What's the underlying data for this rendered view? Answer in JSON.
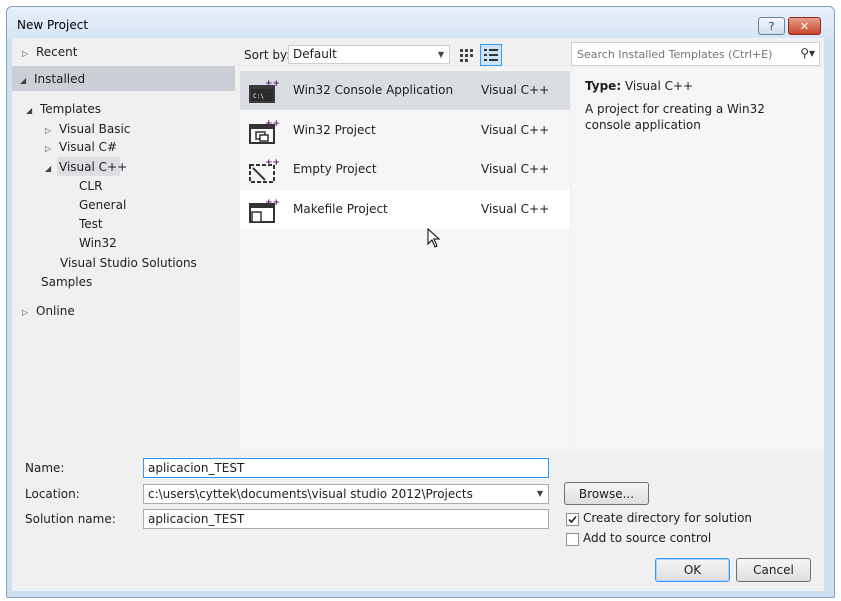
{
  "window": {
    "title": "New Project",
    "help_glyph": "?",
    "close_glyph": "✕"
  },
  "nav": {
    "recent": "Recent",
    "installed": "Installed",
    "templates": "Templates",
    "visual_basic": "Visual Basic",
    "visual_csharp": "Visual C#",
    "visual_cpp": "Visual C++",
    "clr": "CLR",
    "general": "General",
    "test": "Test",
    "win32": "Win32",
    "vs_solutions": "Visual Studio Solutions",
    "samples": "Samples",
    "online": "Online"
  },
  "sort": {
    "label": "Sort by:",
    "value": "Default"
  },
  "search": {
    "placeholder": "Search Installed Templates (Ctrl+E)"
  },
  "templates": [
    {
      "name": "Win32 Console Application",
      "lang": "Visual C++",
      "icon": "console-app-icon",
      "selected": true
    },
    {
      "name": "Win32 Project",
      "lang": "Visual C++",
      "icon": "win32-project-icon",
      "selected": false
    },
    {
      "name": "Empty Project",
      "lang": "Visual C++",
      "icon": "empty-project-icon",
      "selected": false
    },
    {
      "name": "Makefile Project",
      "lang": "Visual C++",
      "icon": "makefile-project-icon",
      "selected": false
    }
  ],
  "details": {
    "type_label": "Type:",
    "type_value": "Visual C++",
    "description": "A project for creating a Win32 console application"
  },
  "form": {
    "name_label": "Name:",
    "name_value": "aplicacion_TEST",
    "location_label": "Location:",
    "location_value": "c:\\users\\cyttek\\documents\\visual studio 2012\\Projects",
    "solution_label": "Solution name:",
    "solution_value": "aplicacion_TEST",
    "browse": "Browse...",
    "create_dir": "Create directory for solution",
    "create_dir_checked": true,
    "add_source": "Add to source control",
    "add_source_checked": false,
    "ok": "OK",
    "cancel": "Cancel"
  },
  "colors": {
    "accent": "#3399ff",
    "title_bg": "#dce9f6",
    "selected_row": "#dadde2",
    "cpp_purple": "#68217a"
  }
}
